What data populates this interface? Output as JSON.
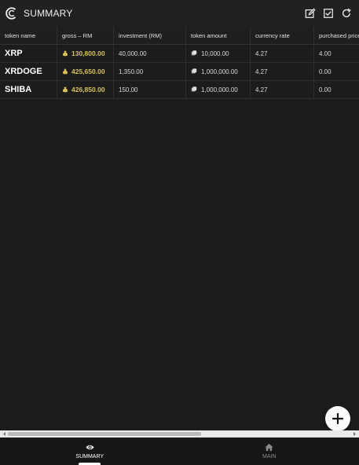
{
  "appbar": {
    "title": "SUMMARY"
  },
  "table": {
    "headers": [
      "token name",
      "gross – RM",
      "investment (RM)",
      "token amount",
      "currency rate",
      "purchased price"
    ],
    "rows": [
      {
        "token": "XRP",
        "gross": "130,800.00",
        "investment": "40,000.00",
        "amount": "10,000.00",
        "rate": "4.27",
        "purchased": "4.00"
      },
      {
        "token": "XRDOGE",
        "gross": "425,650.00",
        "investment": "1,350.00",
        "amount": "1,000,000.00",
        "rate": "4.27",
        "purchased": "0.00"
      },
      {
        "token": "SHIBA",
        "gross": "426,850.00",
        "investment": "150.00",
        "amount": "1,000,000.00",
        "rate": "4.27",
        "purchased": "0.00"
      }
    ]
  },
  "bottom_nav": {
    "summary_label": "SUMMARY",
    "main_label": "MAIN"
  },
  "colors": {
    "gross_text": "#d7c05a",
    "background": "#1c1c1c"
  },
  "icons": {
    "logo": "c-logo-icon",
    "edit": "edit-icon",
    "check": "checkbox-icon",
    "refresh": "refresh-icon",
    "fab": "plus-icon",
    "summary": "eye-icon",
    "main": "home-icon"
  }
}
